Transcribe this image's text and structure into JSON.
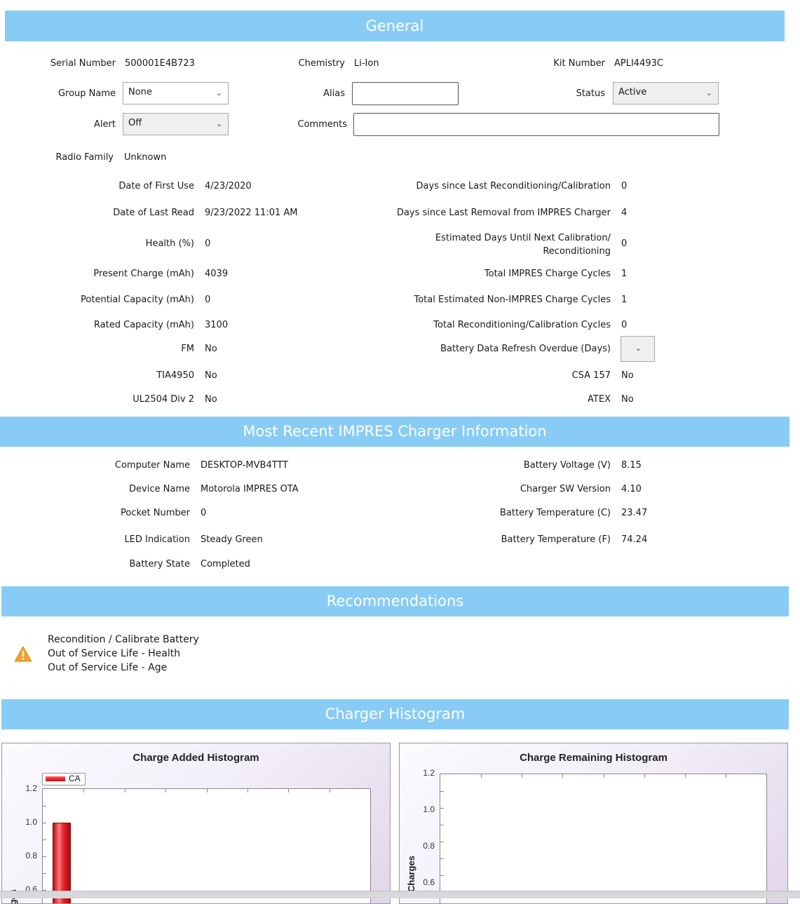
{
  "sections": {
    "general": "General",
    "charger_info": "Most Recent IMPRES Charger Information",
    "recommendations": "Recommendations",
    "histogram": "Charger Histogram"
  },
  "general": {
    "serial_number_label": "Serial Number",
    "serial_number": "500001E4B723",
    "chemistry_label": "Chemistry",
    "chemistry": "Li-Ion",
    "kit_number_label": "Kit Number",
    "kit_number": "APLI4493C",
    "group_name_label": "Group Name",
    "group_name": "None",
    "alias_label": "Alias",
    "alias": "",
    "status_label": "Status",
    "status": "Active",
    "alert_label": "Alert",
    "alert": "Off",
    "comments_label": "Comments",
    "comments": "",
    "radio_family_label": "Radio Family",
    "radio_family": "Unknown",
    "left_rows": [
      {
        "label": "Date of First Use",
        "value": "4/23/2020"
      },
      {
        "label": "Date of Last Read",
        "value": "9/23/2022 11:01 AM"
      },
      {
        "label": "Health (%)",
        "value": "0"
      },
      {
        "label": "Present Charge (mAh)",
        "value": "4039"
      },
      {
        "label": "Potential Capacity (mAh)",
        "value": "0"
      },
      {
        "label": "Rated Capacity (mAh)",
        "value": "3100"
      },
      {
        "label": "FM",
        "value": "No"
      },
      {
        "label": "TIA4950",
        "value": "No"
      },
      {
        "label": "UL2504 Div 2",
        "value": "No"
      }
    ],
    "right_rows": [
      {
        "label": "Days since Last Reconditioning/Calibration",
        "value": "0"
      },
      {
        "label": "Days since Last Removal from IMPRES Charger",
        "value": "4"
      },
      {
        "label": "Estimated Days Until Next Calibration/",
        "label2": "Reconditioning",
        "value": "0"
      },
      {
        "label": "Total IMPRES Charge Cycles",
        "value": "1"
      },
      {
        "label": "Total Estimated Non-IMPRES Charge Cycles",
        "value": "1"
      },
      {
        "label": "Total Reconditioning/Calibration Cycles",
        "value": "0"
      },
      {
        "label": "Battery Data Refresh Overdue (Days)",
        "value": ""
      },
      {
        "label": "CSA 157",
        "value": "No"
      },
      {
        "label": "ATEX",
        "value": "No"
      }
    ]
  },
  "charger": {
    "left_rows": [
      {
        "label": "Computer Name",
        "value": "DESKTOP-MVB4TTT"
      },
      {
        "label": "Device Name",
        "value": "Motorola IMPRES OTA"
      },
      {
        "label": "Pocket Number",
        "value": "0"
      },
      {
        "label": "LED Indication",
        "value": "Steady Green"
      },
      {
        "label": "Battery State",
        "value": "Completed"
      }
    ],
    "right_rows": [
      {
        "label": "Battery Voltage (V)",
        "value": "8.15"
      },
      {
        "label": "Charger SW Version",
        "value": "4.10"
      },
      {
        "label": "Battery Temperature (C)",
        "value": "23.47"
      },
      {
        "label": "Battery Temperature (F)",
        "value": "74.24"
      }
    ]
  },
  "recommendations": {
    "icon": "warning-icon",
    "items": [
      "Recondition / Calibrate Battery",
      "Out of Service Life - Health",
      "Out of Service Life - Age"
    ]
  },
  "chart_data": [
    {
      "type": "bar",
      "title": "Charge Added Histogram",
      "ylabel": "Charges",
      "legend": [
        "CA"
      ],
      "legend_placement": "top-left",
      "ylim": [
        0,
        1.2
      ],
      "yticks": [
        "1.2",
        "1.0",
        "0.8",
        "0.6"
      ],
      "series": [
        {
          "name": "CA",
          "values": [
            1.0
          ]
        }
      ],
      "bar_color": "#e8242a"
    },
    {
      "type": "bar",
      "title": "Charge Remaining Histogram",
      "ylabel": "Charges",
      "ylim": [
        0,
        1.2
      ],
      "yticks": [
        "1.2",
        "1.0",
        "0.8",
        "0.6"
      ],
      "series": []
    }
  ],
  "colors": {
    "section_bar": "#88ccf5",
    "warning": "#f0a030"
  }
}
